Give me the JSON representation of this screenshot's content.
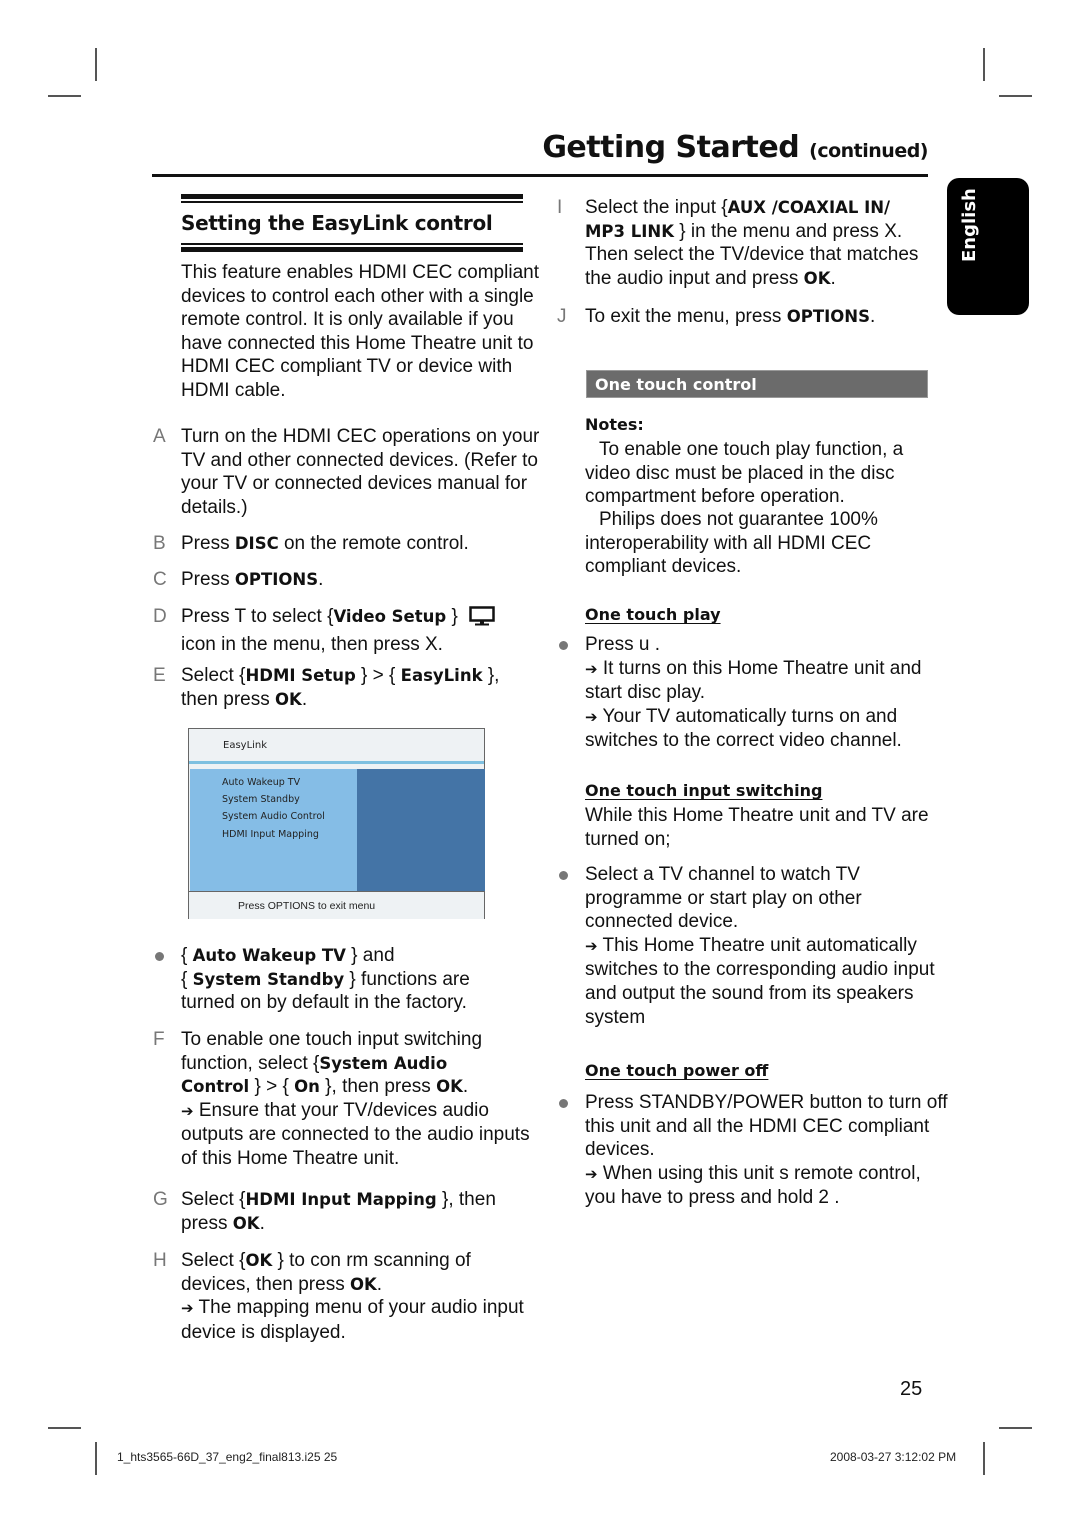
{
  "header": {
    "title": "Getting Started",
    "title_suffix": "(continued)"
  },
  "language_tab": "English",
  "section": {
    "title": "Setting the EasyLink control",
    "intro": "This feature enables HDMI CEC compliant devices to control each other with a single remote control. It is only available if you have connected this Home Theatre unit to HDMI CEC compliant TV or device with HDMI cable."
  },
  "steps": {
    "A": {
      "label": "A",
      "text": "Turn on the HDMI CEC operations on your TV and other connected devices. (Refer to your TV or connected devices manual for details.)"
    },
    "B": {
      "label": "B",
      "pre": "Press ",
      "bold": "DISC",
      "post": " on the remote control."
    },
    "C": {
      "label": "C",
      "pre": "Press ",
      "bold": "OPTIONS",
      "post": "."
    },
    "D": {
      "label": "D",
      "pre": "Press T  to select  {",
      "bold": "Video Setup",
      "post": " }",
      "line2": "icon in the menu, then press X.",
      "icon": "monitor-icon"
    },
    "E": {
      "label": "E",
      "pre": "Select {",
      "bold1": "HDMI Setup",
      "mid": " } > { ",
      "bold2": "EasyLink",
      "post": " },",
      "line2_pre": "then press ",
      "line2_bold": "OK",
      "line2_post": "."
    },
    "bullet1": {
      "pre": "{ ",
      "bold1": "Auto Wakeup TV",
      "mid": " } and",
      "pre2": "{ ",
      "bold2": "System Standby",
      "post2": " } functions are",
      "line3": "turned on by default in the factory."
    },
    "F": {
      "label": "F",
      "line1": "To enable one touch input switching",
      "line2_pre": "function, select {",
      "bold1": "System Audio",
      "bold2": "Control",
      "mid": " } > { ",
      "bold3": "On",
      "post": " }, then press ",
      "bold4": "OK",
      "end": ".",
      "result": "Ensure that your TV/devices audio outputs are connected to the audio inputs of this Home Theatre unit."
    },
    "G": {
      "label": "G",
      "pre": "Select {",
      "bold": "HDMI Input Mapping",
      "post": " }, then",
      "line2_pre": "press ",
      "line2_bold": "OK",
      "line2_post": "."
    },
    "H": {
      "label": "H",
      "pre": "Select {",
      "bold": "OK",
      "post": " } to con rm scanning of",
      "line2_pre": "devices, then press ",
      "line2_bold": "OK",
      "line2_post": ".",
      "result": "The mapping menu of your audio input device is displayed."
    },
    "I": {
      "label": "I",
      "pre": "Select the input {",
      "bold": "AUX /COAXIAL IN/",
      "bold2": "MP3 LINK",
      "post": " } in the menu and press X.",
      "line3": "Then select the TV/device that matches",
      "line4_pre": "the audio input and press ",
      "line4_bold": "OK",
      "line4_post": "."
    },
    "J": {
      "label": "J",
      "pre": "To exit the menu, press ",
      "bold": "OPTIONS",
      "post": "."
    }
  },
  "menu_screen": {
    "title": "EasyLink",
    "items": [
      "Auto Wakeup TV",
      "System Standby",
      "System Audio Control",
      "HDMI Input Mapping"
    ],
    "footer": "Press OPTIONS to exit menu",
    "colors": {
      "left_panel": "#85bde6",
      "right_panel": "#4474a6"
    }
  },
  "one_touch": {
    "bar_title": "One touch control",
    "notes_label": "Notes:",
    "note1": "To enable one touch play function, a video disc must be placed in the disc compartment before operation.",
    "note2": "Philips does not guarantee 100% interoperability with all HDMI CEC compliant devices.",
    "play": {
      "heading": "One touch play",
      "bullet": "Press u    .",
      "result1": "It turns on this Home Theatre unit and start disc play.",
      "result2": "Your TV automatically turns on and switches to the correct video channel."
    },
    "input": {
      "heading": "One touch input switching",
      "intro": "While this Home Theatre unit and TV are turned on;",
      "bullet": "Select a TV channel to watch TV programme or start play on other connected device.",
      "result": "This Home Theatre unit automatically switches to the corresponding audio input and output the sound from its speakers system"
    },
    "power": {
      "heading": "One touch power off",
      "bullet": "Press STANDBY/POWER button to turn off this unit and all the HDMI CEC compliant devices.",
      "result": "When using this unit s remote control, you have to press and hold 2 ."
    }
  },
  "arrow_glyph": "➔",
  "page_number": "25",
  "footer": {
    "left": "1_hts3565-66D_37_eng2_final813.i25   25",
    "right": "2008-03-27   3:12:02 PM"
  }
}
